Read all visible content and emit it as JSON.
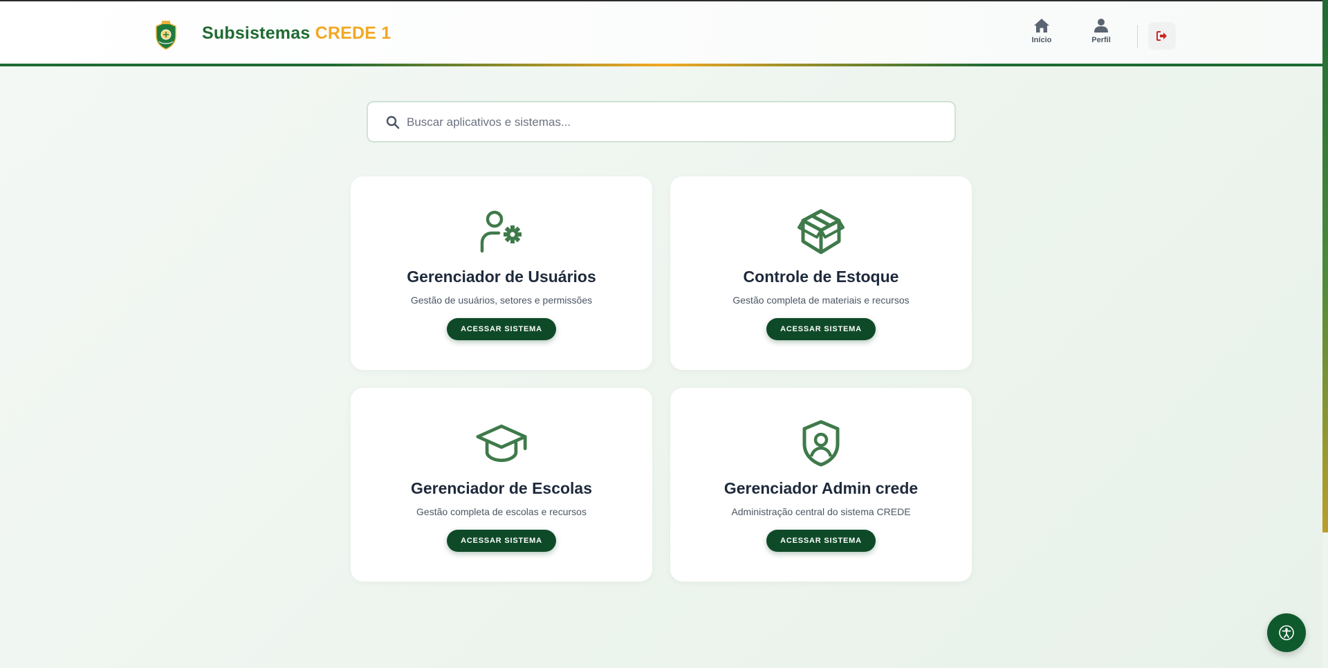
{
  "header": {
    "brand_part1": "Subsistemas",
    "brand_part2": "CREDE 1",
    "nav": [
      {
        "label": "Início",
        "icon": "home-icon"
      },
      {
        "label": "Perfil",
        "icon": "user-icon"
      }
    ],
    "logout_icon": "logout-icon"
  },
  "search": {
    "placeholder": "Buscar aplicativos e sistemas...",
    "value": ""
  },
  "cards": [
    {
      "title": "Gerenciador de Usuários",
      "description": "Gestão de usuários, setores e permissões",
      "button": "ACESSAR SISTEMA",
      "icon": "user-gear-icon"
    },
    {
      "title": "Controle de Estoque",
      "description": "Gestão completa de materiais e recursos",
      "button": "ACESSAR SISTEMA",
      "icon": "box-icon"
    },
    {
      "title": "Gerenciador de Escolas",
      "description": "Gestão completa de escolas e recursos",
      "button": "ACESSAR SISTEMA",
      "icon": "graduation-cap-icon"
    },
    {
      "title": "Gerenciador Admin crede",
      "description": "Administração central do sistema CREDE",
      "button": "ACESSAR SISTEMA",
      "icon": "shield-user-icon"
    }
  ],
  "colors": {
    "brand_green": "#1f6b32",
    "brand_orange": "#f2a823",
    "button_green": "#0f4a28",
    "icon_green": "#3f7a4a",
    "logout_red": "#c62828"
  },
  "accessibility": {
    "icon": "accessibility-icon"
  }
}
